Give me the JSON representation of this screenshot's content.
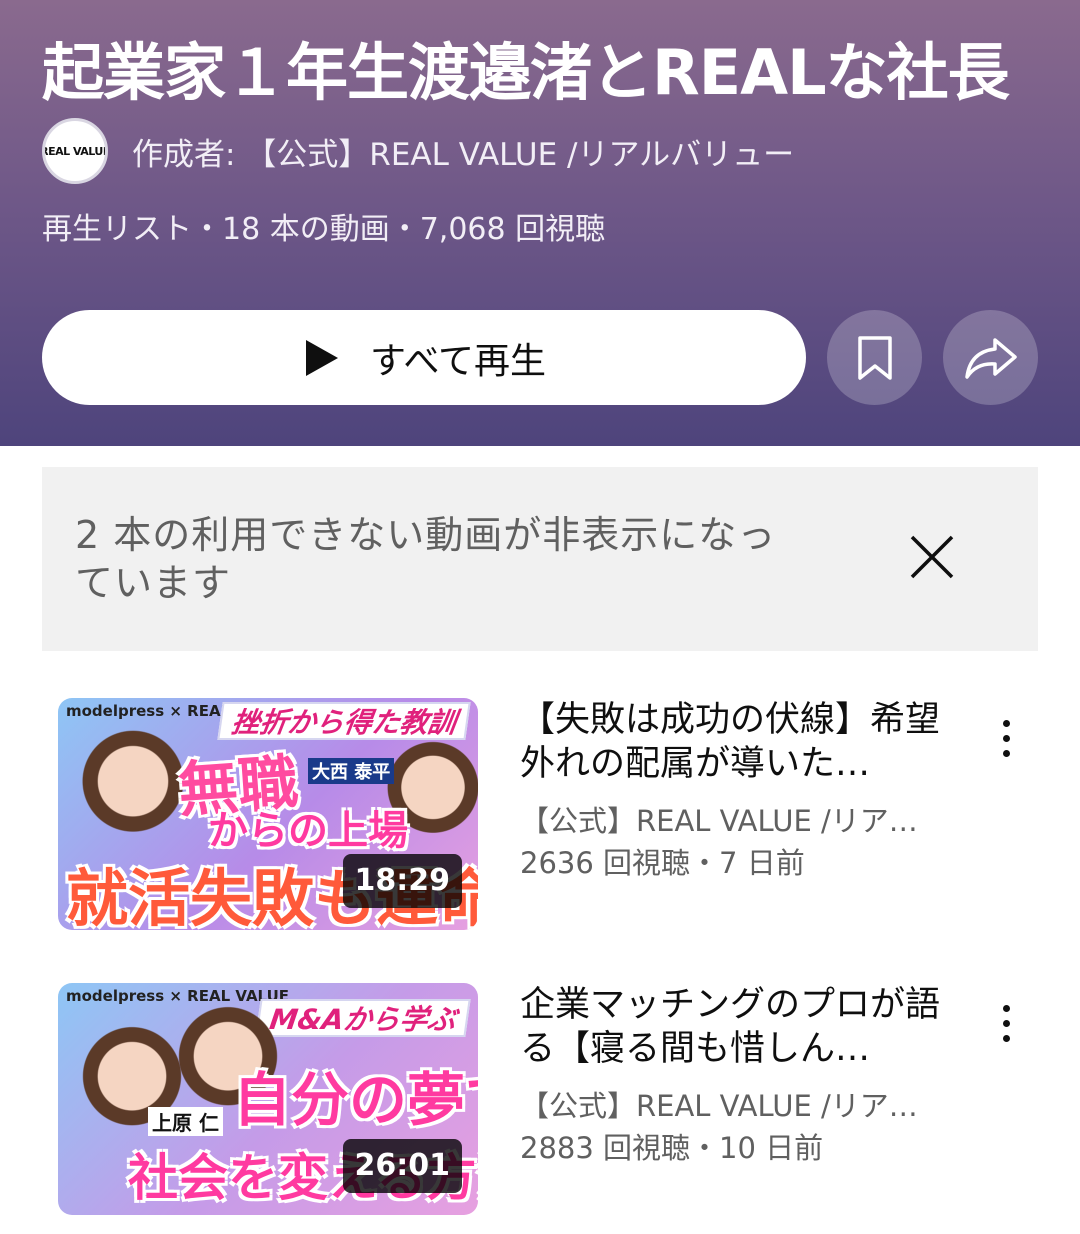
{
  "playlist": {
    "title": "起業家１年生渡邉渚とREALな社長",
    "avatar_text": "REAL VALUE",
    "creator": "作成者: 【公式】REAL VALUE /リアルバリュー",
    "meta": "再生リスト・18 本の動画・7,068 回視聴",
    "play_all_label": "すべて再生",
    "play_icon": "play-icon",
    "save_icon": "bookmark-icon",
    "share_icon": "share-icon"
  },
  "notice": {
    "text": "2 本の利用できない動画が非表示になっています",
    "close_icon": "close-icon"
  },
  "videos": [
    {
      "title": "【失敗は成功の伏線】希望外れの配属が導いた…",
      "channel": "【公式】REAL VALUE /リア…",
      "stats": "2636 回視聴・7 日前",
      "duration": "18:29",
      "thumb_brand": "modelpress × REAL VALUE",
      "thumb_tag": "挫折から得た教訓",
      "thumb_text_1": "無職",
      "thumb_text_2": "からの上場",
      "thumb_text_3": "就活失敗も運命",
      "thumb_person_label": "大西 泰平"
    },
    {
      "title": "企業マッチングのプロが語る【寝る間も惜しん…",
      "channel": "【公式】REAL VALUE /リア…",
      "stats": "2883 回視聴・10 日前",
      "duration": "26:01",
      "thumb_brand": "modelpress × REAL VALUE",
      "thumb_tag": "M&Aから学ぶ",
      "thumb_text_1": "自分の夢で",
      "thumb_text_2": "社会を変える方法",
      "thumb_text_3": "",
      "thumb_person_label": "上原 仁"
    }
  ],
  "colors": {
    "header_top": "#8a6a8e",
    "header_bottom": "#4e447c",
    "thumb_accent": "#ff4ba0"
  }
}
